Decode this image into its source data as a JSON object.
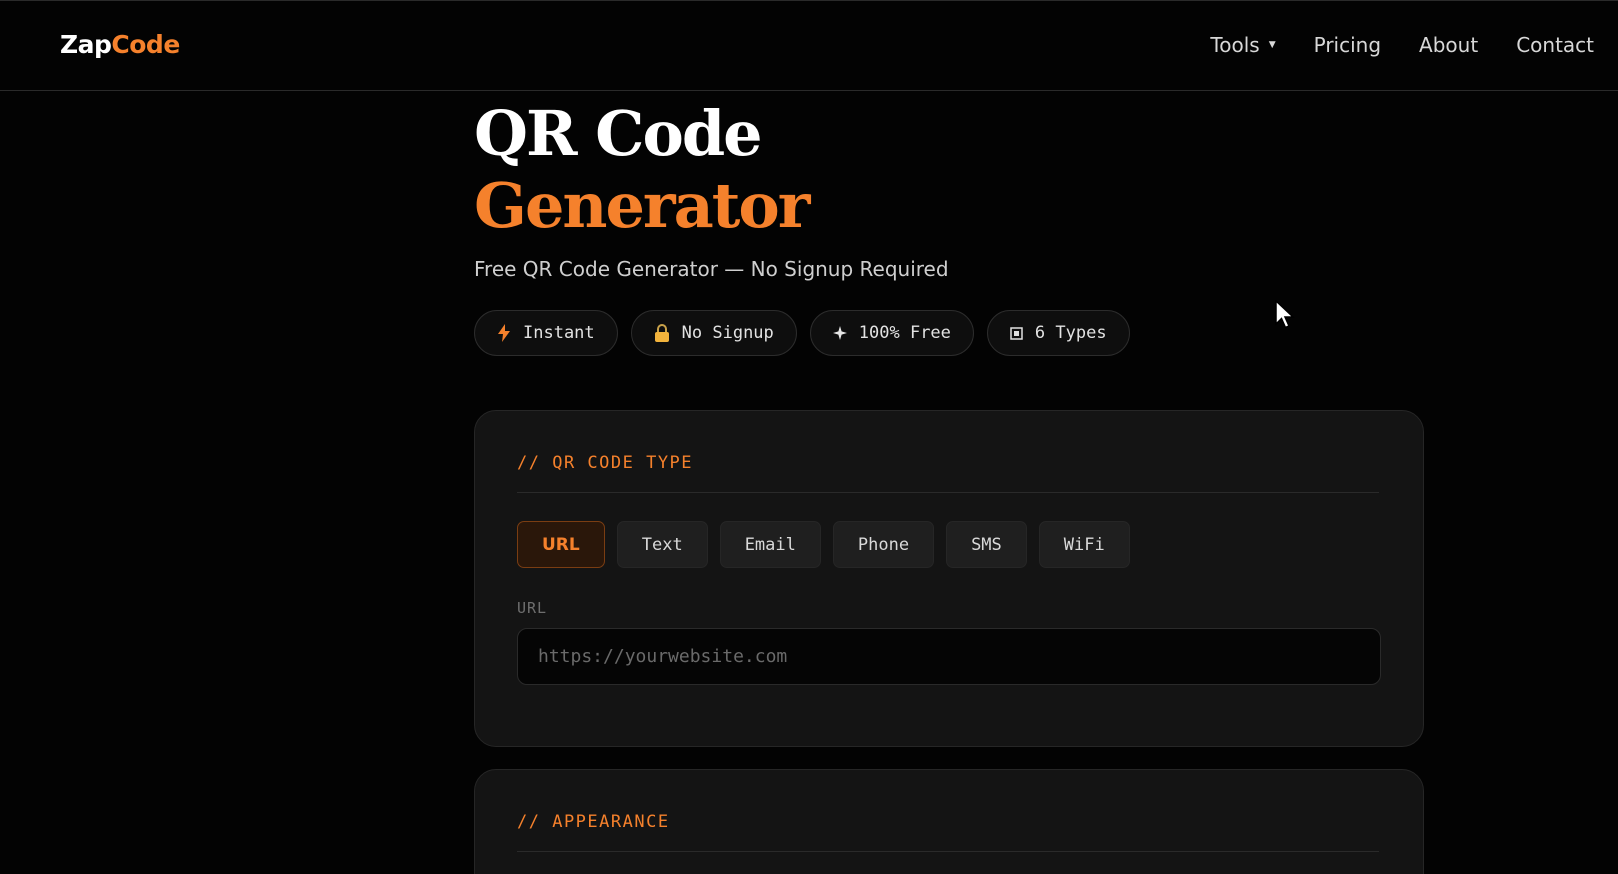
{
  "brand": {
    "part1": "Zap",
    "part2": "Code"
  },
  "nav": {
    "items": [
      {
        "label": "Tools",
        "has_dropdown": true
      },
      {
        "label": "Pricing"
      },
      {
        "label": "About"
      },
      {
        "label": "Contact"
      }
    ]
  },
  "hero": {
    "title_line1": "QR Code",
    "title_line2": "Generator",
    "subtitle": "Free QR Code Generator — No Signup Required"
  },
  "badges": [
    {
      "icon": "lightning-icon",
      "label": "Instant"
    },
    {
      "icon": "lock-icon",
      "label": "No Signup"
    },
    {
      "icon": "sparkle-icon",
      "label": "100% Free"
    },
    {
      "icon": "square-icon",
      "label": "6 Types"
    }
  ],
  "qr_type": {
    "section_label": "// QR CODE TYPE",
    "tabs": [
      "URL",
      "Text",
      "Email",
      "Phone",
      "SMS",
      "WiFi"
    ],
    "active_tab": "URL",
    "field_label": "URL",
    "input_value": "",
    "input_placeholder": "https://yourwebsite.com"
  },
  "appearance": {
    "section_label": "// APPEARANCE"
  },
  "colors": {
    "accent": "#f5812c",
    "background": "#030303",
    "card": "#141414"
  }
}
